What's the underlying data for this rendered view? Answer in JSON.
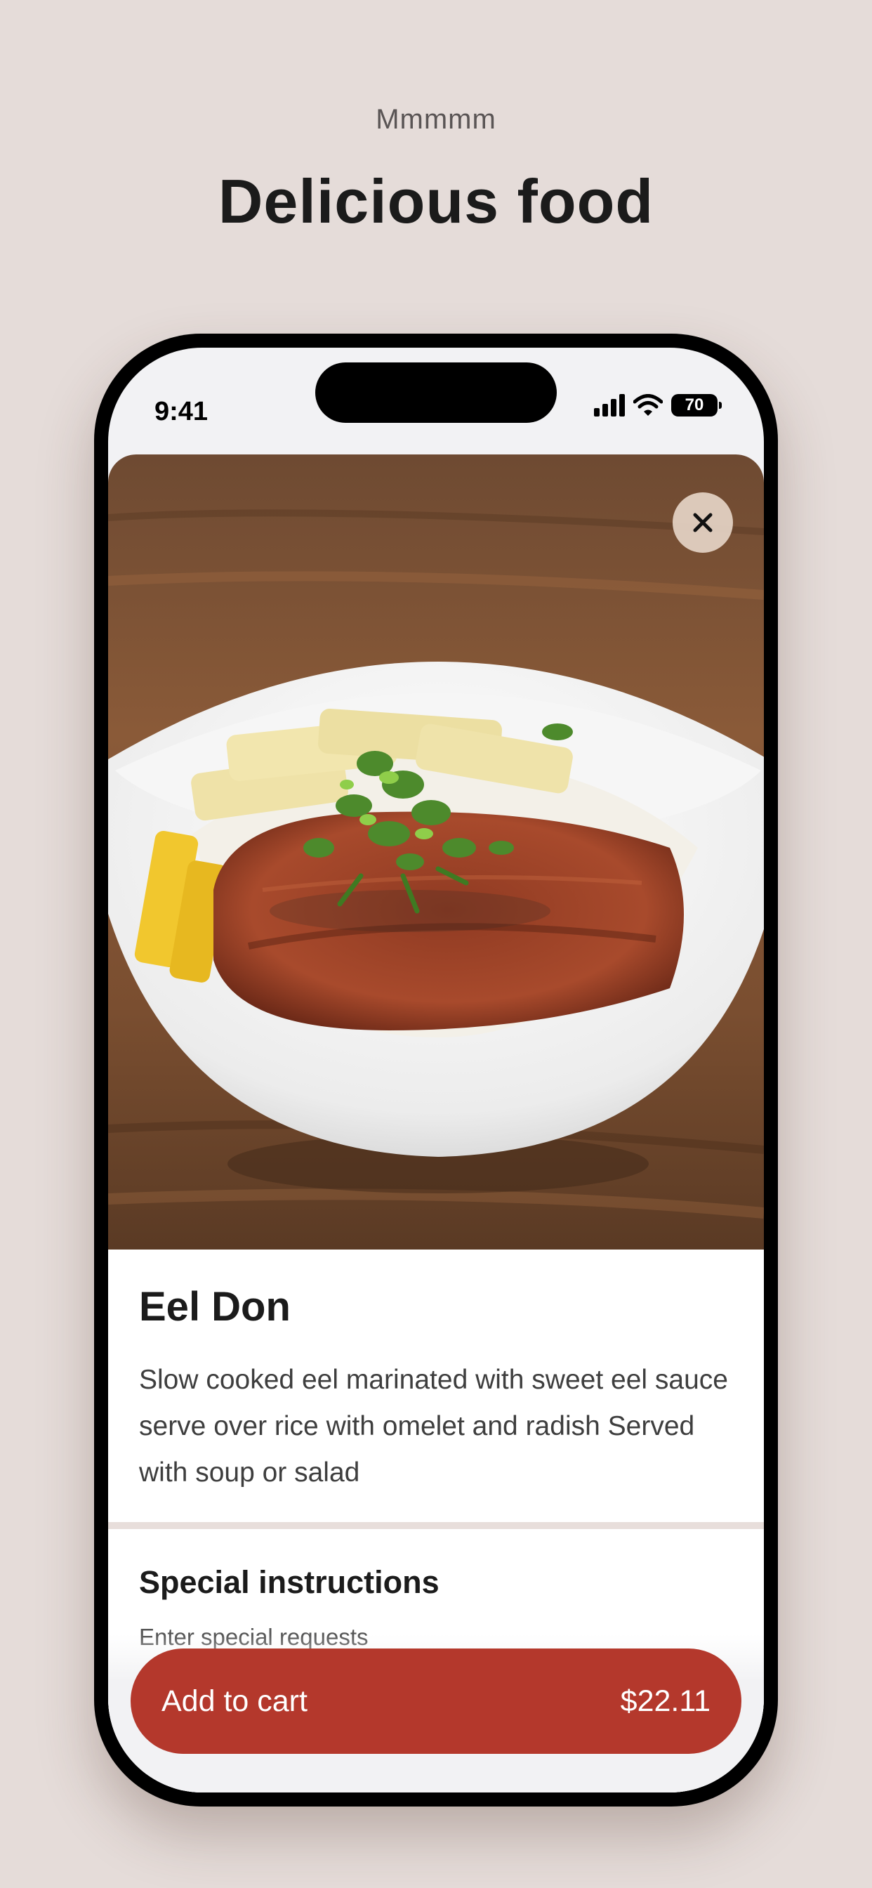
{
  "promo": {
    "subtitle": "Mmmmm",
    "title": "Delicious food"
  },
  "status_bar": {
    "time": "9:41",
    "battery": "70",
    "icons": [
      "cellular-signal-icon",
      "wifi-icon",
      "battery-icon"
    ]
  },
  "item": {
    "image_alt": "Eel Don",
    "title": "Eel Don",
    "description": "Slow cooked eel marinated with sweet eel sauce serve over rice with omelet and radish Served with soup or salad"
  },
  "special_instructions": {
    "title": "Special instructions",
    "placeholder": "Enter special requests"
  },
  "cart": {
    "label": "Add to cart",
    "price": "$22.11"
  },
  "colors": {
    "background": "#e5dcd9",
    "accent": "#b4382c",
    "close_button": "#e5d4c5"
  }
}
